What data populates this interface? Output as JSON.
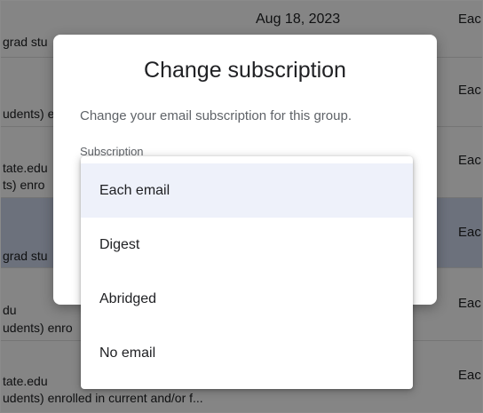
{
  "background_rows": [
    {
      "line1": "",
      "line2": "grad stu",
      "date": "Aug 18, 2023",
      "subscription": "Eac",
      "selected": false
    },
    {
      "line1": "",
      "line2": "udents) e",
      "date": "",
      "subscription": "Eac",
      "selected": false
    },
    {
      "line1": "tate.edu",
      "line2": "ts) enro",
      "date": "",
      "subscription": "Eac",
      "selected": false
    },
    {
      "line1": "",
      "line2": "grad stu",
      "date": "",
      "subscription": "Eac",
      "selected": true
    },
    {
      "line1": "du",
      "line2": "udents) enro",
      "date": "",
      "subscription": "Eac",
      "selected": false
    },
    {
      "line1": "tate.edu",
      "line2": "udents) enrolled in current and/or f...",
      "date": "",
      "subscription": "Eac",
      "selected": false
    }
  ],
  "dialog": {
    "title": "Change subscription",
    "description": "Change your email subscription for this group.",
    "field_label": "Subscription"
  },
  "dropdown": {
    "selected": "Each email",
    "options": [
      "Each email",
      "Digest",
      "Abridged",
      "No email"
    ]
  }
}
